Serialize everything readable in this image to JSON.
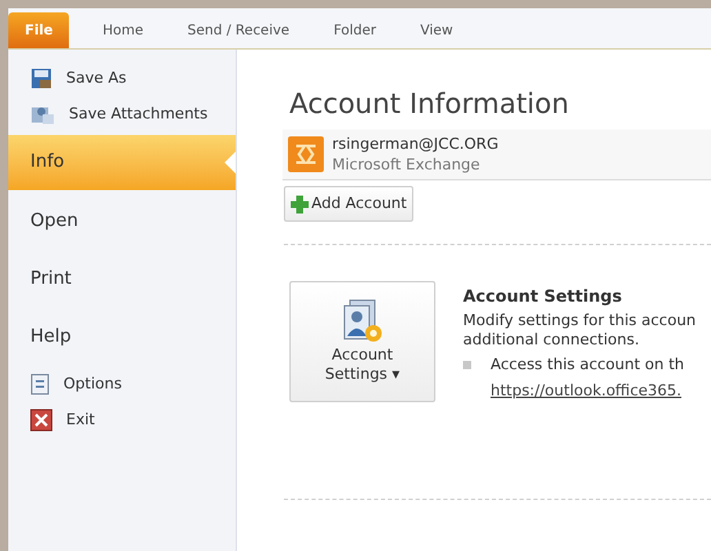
{
  "tabs": [
    {
      "label": "File",
      "selected": true
    },
    {
      "label": "Home",
      "selected": false
    },
    {
      "label": "Send / Receive",
      "selected": false
    },
    {
      "label": "Folder",
      "selected": false
    },
    {
      "label": "View",
      "selected": false
    }
  ],
  "sidebar": {
    "items": [
      {
        "label": "Save As",
        "kind": "small",
        "selected": false
      },
      {
        "label": "Save Attachments",
        "kind": "small",
        "selected": false
      },
      {
        "label": "Info",
        "kind": "large",
        "selected": true
      },
      {
        "label": "Open",
        "kind": "large",
        "selected": false
      },
      {
        "label": "Print",
        "kind": "large",
        "selected": false
      },
      {
        "label": "Help",
        "kind": "large",
        "selected": false
      },
      {
        "label": "Options",
        "kind": "small",
        "selected": false
      },
      {
        "label": "Exit",
        "kind": "small",
        "selected": false
      }
    ]
  },
  "main": {
    "title": "Account Information",
    "account": {
      "email": "rsingerman@JCC.ORG",
      "type": "Microsoft Exchange"
    },
    "add_account_button": "Add Account",
    "account_settings": {
      "button_line_1": "Account",
      "button_line_2": "Settings",
      "button_caret": "▾",
      "heading": "Account Settings",
      "description": "Modify settings for this accoun\nadditional connections.",
      "bullet": "Access this account on th",
      "link": "https://outlook.office365."
    }
  }
}
